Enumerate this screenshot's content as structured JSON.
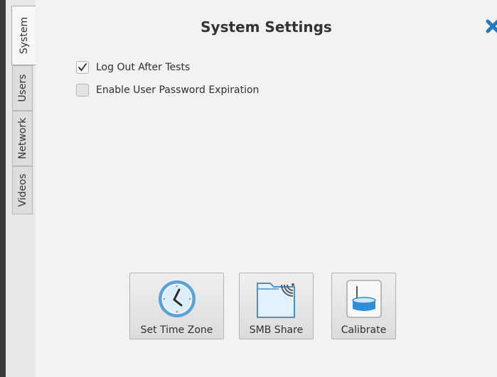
{
  "dialog": {
    "title": "System Settings",
    "close_icon": "close-x-icon",
    "accent_color": "#1f78c8"
  },
  "tabs": [
    {
      "label": "System",
      "active": true
    },
    {
      "label": "Users",
      "active": false
    },
    {
      "label": "Network",
      "active": false
    },
    {
      "label": "Videos",
      "active": false
    }
  ],
  "options": [
    {
      "label": "Log Out After Tests",
      "checked": true
    },
    {
      "label": "Enable User Password Expiration",
      "checked": false
    }
  ],
  "actions": [
    {
      "label": "Set Time Zone",
      "icon": "clock-icon"
    },
    {
      "label": "SMB Share",
      "icon": "folder-share-icon"
    },
    {
      "label": "Calibrate",
      "icon": "calibrate-icon"
    }
  ]
}
